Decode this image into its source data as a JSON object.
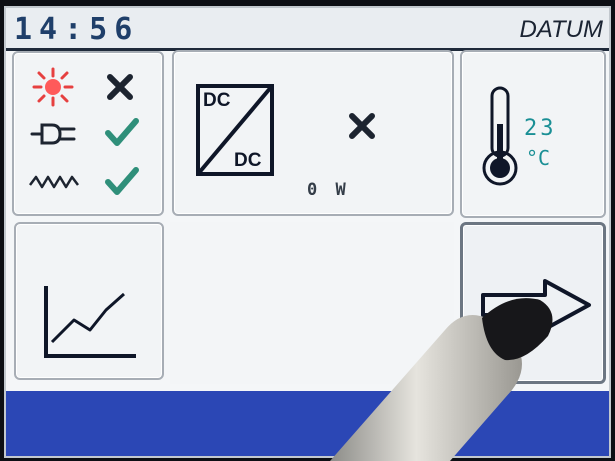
{
  "header": {
    "time": "14:56",
    "date_label": "DATUM"
  },
  "status_panel": {
    "rows": [
      {
        "icon": "sun-icon",
        "state": "error",
        "state_icon": "cross-icon"
      },
      {
        "icon": "power-plug-icon",
        "state": "ok",
        "state_icon": "check-icon"
      },
      {
        "icon": "ac-wave-icon",
        "state": "ok",
        "state_icon": "check-icon"
      }
    ]
  },
  "dcdc_panel": {
    "label_top": "DC",
    "label_bottom": "DC",
    "state_icon": "cross-icon",
    "power": "0 W"
  },
  "temperature_panel": {
    "icon": "thermometer-icon",
    "value": "23",
    "unit": "°C"
  },
  "chart_button": {
    "icon": "line-chart-icon"
  },
  "next_button": {
    "icon": "right-arrow-icon"
  },
  "colors": {
    "accent_cyan": "#1a8f95",
    "footer_blue": "#2b47b5",
    "check_green": "#2f8f7a",
    "cross_dark": "#1d2430",
    "sun_red": "#e64040"
  }
}
